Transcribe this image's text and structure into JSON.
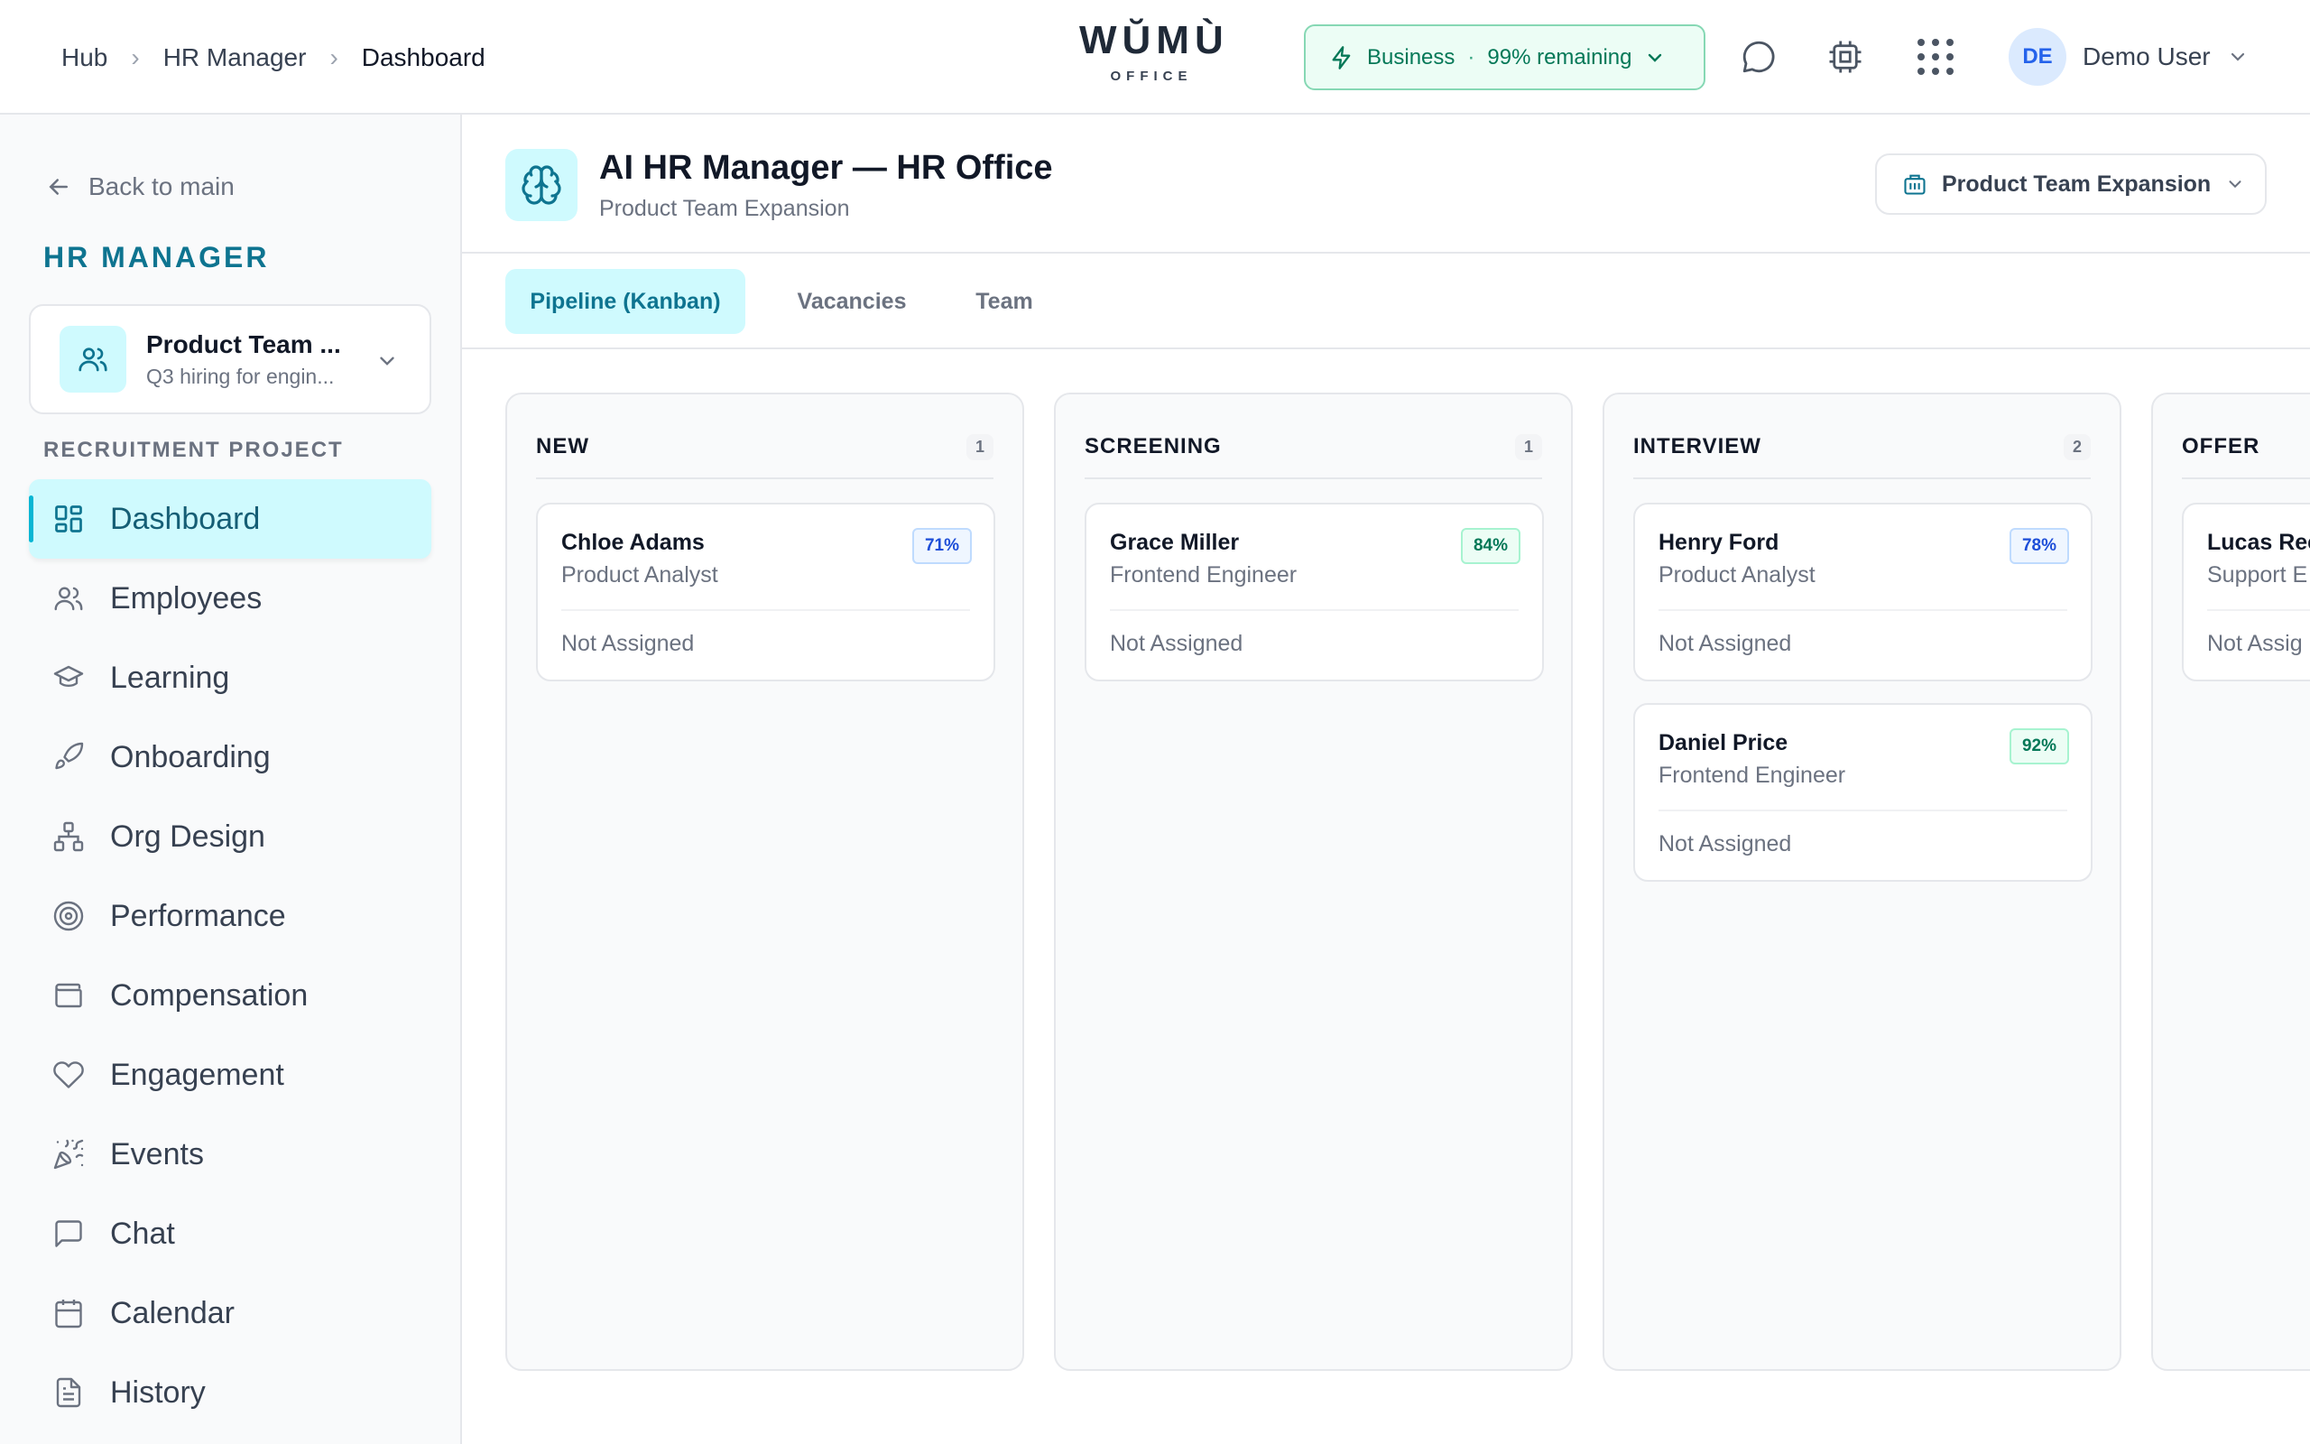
{
  "breadcrumb": {
    "hub": "Hub",
    "hr_manager": "HR Manager",
    "dashboard": "Dashboard",
    "separator": "›"
  },
  "logo": {
    "word": "WŬMÙ",
    "sub": "OFFICE"
  },
  "plan": {
    "tier": "Business",
    "dot": "·",
    "remaining": "99% remaining"
  },
  "user": {
    "initials": "DE",
    "name": "Demo User"
  },
  "sidebar": {
    "back": "Back to main",
    "title": "HR MANAGER",
    "project": {
      "name": "Product Team ...",
      "desc": "Q3 hiring for engin..."
    },
    "section": "RECRUITMENT PROJECT",
    "items": [
      {
        "label": "Dashboard",
        "icon": "dashboard-icon"
      },
      {
        "label": "Employees",
        "icon": "users-icon"
      },
      {
        "label": "Learning",
        "icon": "graduation-cap-icon"
      },
      {
        "label": "Onboarding",
        "icon": "rocket-icon"
      },
      {
        "label": "Org Design",
        "icon": "org-chart-icon"
      },
      {
        "label": "Performance",
        "icon": "target-icon"
      },
      {
        "label": "Compensation",
        "icon": "wallet-icon"
      },
      {
        "label": "Engagement",
        "icon": "heart-icon"
      },
      {
        "label": "Events",
        "icon": "party-popper-icon"
      },
      {
        "label": "Chat",
        "icon": "chat-icon"
      },
      {
        "label": "Calendar",
        "icon": "calendar-icon"
      },
      {
        "label": "History",
        "icon": "document-icon"
      }
    ]
  },
  "header": {
    "title": "AI HR Manager — HR Office",
    "subtitle": "Product Team Expansion",
    "project_select": "Product Team Expansion"
  },
  "tabs": [
    {
      "label": "Pipeline (Kanban)"
    },
    {
      "label": "Vacancies"
    },
    {
      "label": "Team"
    }
  ],
  "board": {
    "columns": [
      {
        "title": "NEW",
        "count": "1",
        "cards": [
          {
            "name": "Chloe Adams",
            "role": "Product Analyst",
            "score": "71%",
            "score_tone": "blue",
            "assign": "Not Assigned"
          }
        ]
      },
      {
        "title": "SCREENING",
        "count": "1",
        "cards": [
          {
            "name": "Grace Miller",
            "role": "Frontend Engineer",
            "score": "84%",
            "score_tone": "green",
            "assign": "Not Assigned"
          }
        ]
      },
      {
        "title": "INTERVIEW",
        "count": "2",
        "cards": [
          {
            "name": "Henry Ford",
            "role": "Product Analyst",
            "score": "78%",
            "score_tone": "blue",
            "assign": "Not Assigned"
          },
          {
            "name": "Daniel Price",
            "role": "Frontend Engineer",
            "score": "92%",
            "score_tone": "green",
            "assign": "Not Assigned"
          }
        ]
      },
      {
        "title": "OFFER",
        "count": "",
        "cards": [
          {
            "name": "Lucas Ree",
            "role": "Support E",
            "score": "",
            "score_tone": "",
            "assign": "Not Assig"
          }
        ]
      }
    ]
  },
  "colors": {
    "accent": "#0e7490",
    "accent_bg": "#cffafe",
    "plan_green": "#047857"
  }
}
